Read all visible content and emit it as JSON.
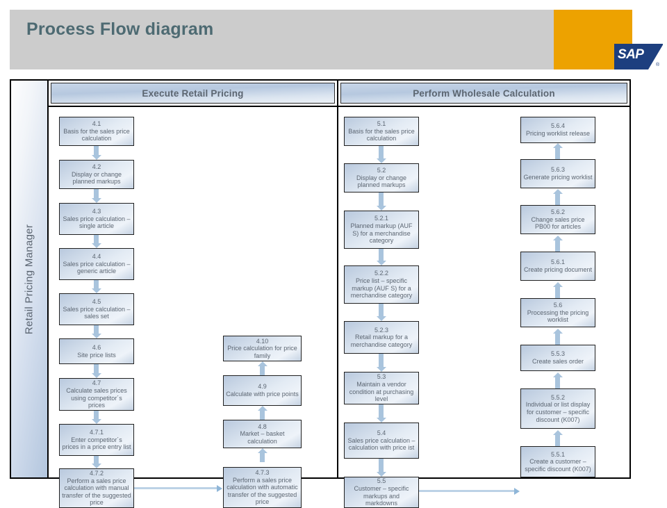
{
  "header": {
    "title": "Process Flow diagram",
    "logo_text": "SAP",
    "logo_registered": "®"
  },
  "diagram": {
    "role_label": "Retail Pricing Manager",
    "lanes": [
      {
        "title": "Execute Retail Pricing"
      },
      {
        "title": "Perform Wholesale Calculation"
      }
    ]
  },
  "boxes": {
    "b41": {
      "num": "4.1",
      "label": "Basis for the sales price calculation"
    },
    "b42": {
      "num": "4.2",
      "label": "Display or change planned markups"
    },
    "b43": {
      "num": "4.3",
      "label": "Sales price calculation – single article"
    },
    "b44": {
      "num": "4.4",
      "label": "Sales price calculation – generic article"
    },
    "b45": {
      "num": "4.5",
      "label": "Sales price calculation – sales set"
    },
    "b46": {
      "num": "4.6",
      "label": "Site price lists"
    },
    "b47": {
      "num": "4.7",
      "label": "Calculate sales prices using competitor´s prices"
    },
    "b471": {
      "num": "4.7.1",
      "label": "Enter competitor´s prices in a price entry list"
    },
    "b472": {
      "num": "4.7.2",
      "label": "Perform a sales price calculation with manual transfer of the suggested price"
    },
    "b473": {
      "num": "4.7.3",
      "label": "Perform a sales price calculation with automatic transfer of the suggested price"
    },
    "b48": {
      "num": "4.8",
      "label": "Market – basket calculation"
    },
    "b49": {
      "num": "4.9",
      "label": "Calculate with price points"
    },
    "b410": {
      "num": "4.10",
      "label": "Price calculation for price family"
    },
    "b51": {
      "num": "5.1",
      "label": "Basis for the sales price calculation"
    },
    "b52": {
      "num": "5.2",
      "label": "Display or change planned markups"
    },
    "b521": {
      "num": "5.2.1",
      "label": "Planned markup (AUF S) for a merchandise category"
    },
    "b522": {
      "num": "5.2.2",
      "label": "Price list – specific markup (AUF S) for a merchandise category"
    },
    "b523": {
      "num": "5.2.3",
      "label": "Retail markup for a merchandise category"
    },
    "b53": {
      "num": "5.3",
      "label": "Maintain a vendor condition at purchasing level"
    },
    "b54": {
      "num": "5.4",
      "label": "Sales price calculation – calculation with price ist"
    },
    "b55": {
      "num": "5.5",
      "label": "Customer – specific markups and markdowns"
    },
    "b551": {
      "num": "5.5.1",
      "label": "Create a customer – specific discount (K007)"
    },
    "b552": {
      "num": "5.5.2",
      "label": "Individual or list display for customer – specific discount (K007)"
    },
    "b553": {
      "num": "5.5.3",
      "label": "Create sales order"
    },
    "b56": {
      "num": "5.6",
      "label": "Processing the pricing worklist"
    },
    "b561": {
      "num": "5.6.1",
      "label": "Create pricing document"
    },
    "b562": {
      "num": "5.6.2",
      "label": "Change sales price PB00 for articles"
    },
    "b563": {
      "num": "5.6.3",
      "label": "Generate pricing worklist"
    },
    "b564": {
      "num": "5.6.4",
      "label": "Pricing worklist release"
    }
  },
  "colors": {
    "header_band": "#cccccc",
    "sap_orange": "#eda200",
    "sap_blue": "#1d3f7f",
    "title_text": "#4d6a72",
    "arrow": "#a9c4dd",
    "box_text": "#5c6672"
  }
}
